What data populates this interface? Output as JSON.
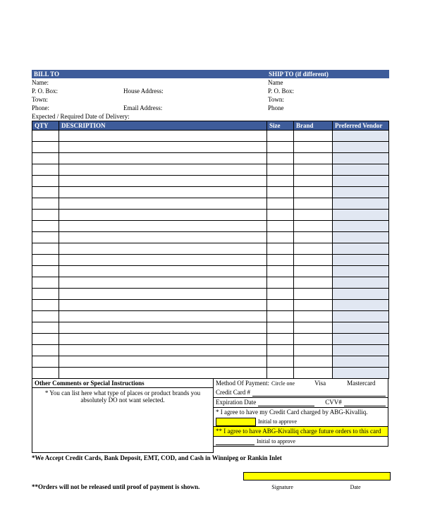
{
  "billto": {
    "header": "BILL TO",
    "name": "Name:",
    "po": "P. O. Box:",
    "house": "House Address:",
    "town": "Town:",
    "phone": "Phone:",
    "email": "Email Address:"
  },
  "shipto": {
    "header": "SHIP TO (if different)",
    "name": "Name",
    "po": "P. O. Box:",
    "town": "Town:",
    "phone": "Phone"
  },
  "delivery": "Expected / Required Date of Delivery:",
  "cols": {
    "qty": "QTY",
    "desc": "DESCRIPTION",
    "size": "Size",
    "brand": "Brand",
    "vendor": "Preferred Vendor"
  },
  "comments": {
    "title": "Other Comments or Special Instructions",
    "text": "* You can list here what type of places or product brands you absolutely DO not want selected."
  },
  "payment": {
    "method": "Method Of Payment:",
    "circle": "Circle one",
    "visa": "Visa",
    "mc": "Mastercard",
    "cc": "Credit Card #",
    "exp": "Expiration Date",
    "cvv": "CVV#",
    "agree1": "* I agree to have my Credit Card charged by ABG-Kivalliq.",
    "agree2": "** I agree to have ABG-Kivalliq charge future orders to this card",
    "initial": "Initial to approve"
  },
  "footer": {
    "accept": "*We Accept Credit Cards, Bank Deposit, EMT, COD, and Cash in Winnipeg or Rankin Inlet",
    "release": "**Orders will not be released until proof of payment is shown.",
    "sig": "Signature",
    "date": "Date"
  }
}
